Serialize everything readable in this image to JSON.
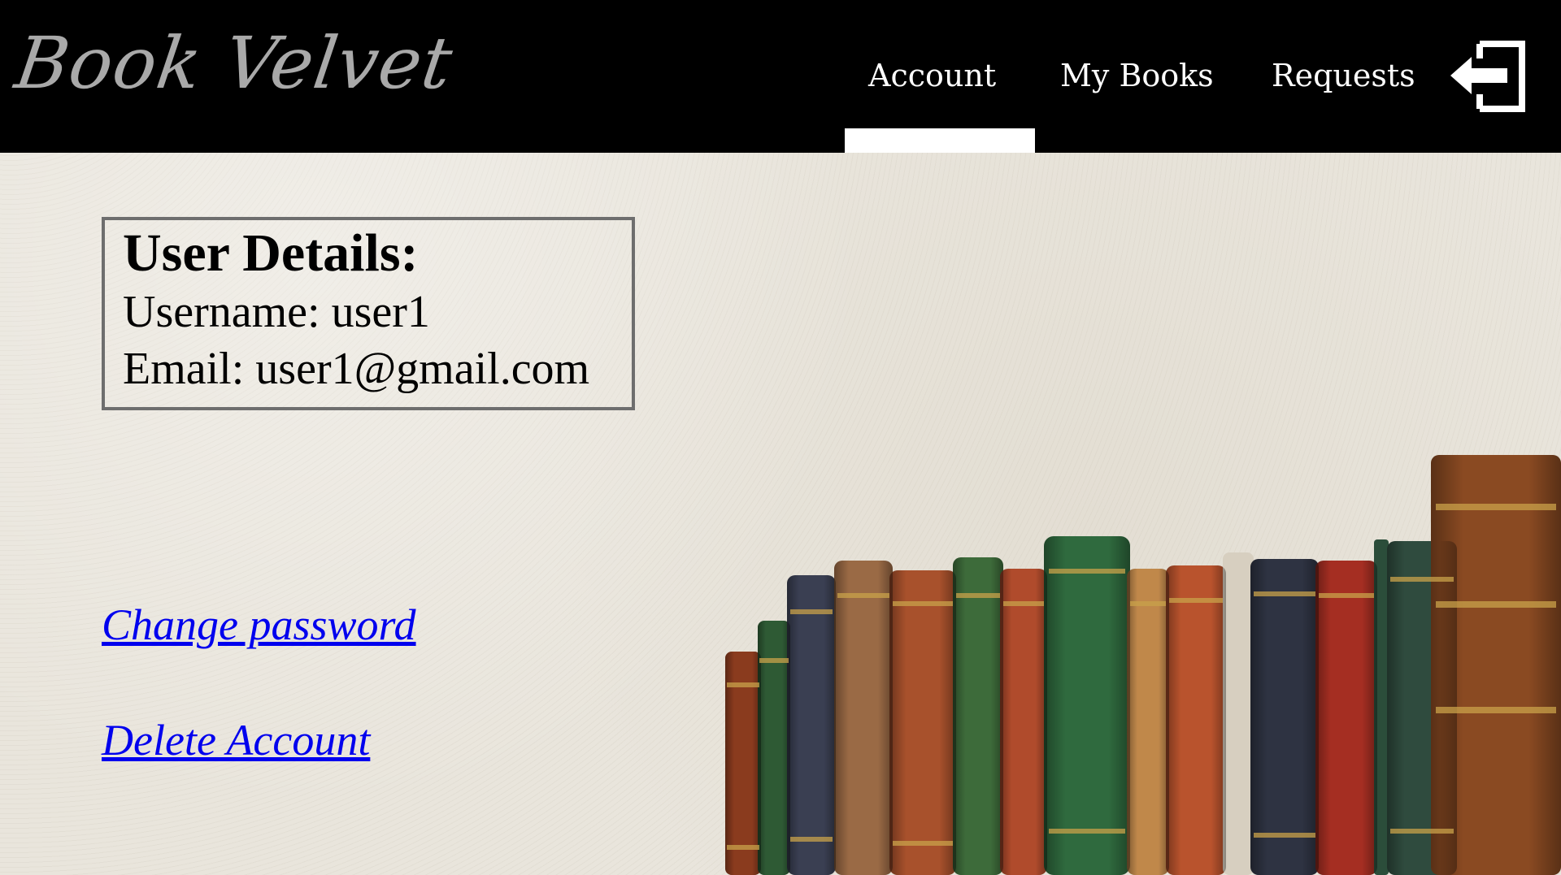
{
  "header": {
    "logo_text": "Book Velvet",
    "nav": {
      "account_label": "Account",
      "my_books_label": "My Books",
      "requests_label": "Requests"
    },
    "active_tab": "Account",
    "logout_icon": "logout-icon"
  },
  "user_details": {
    "title": "User Details:",
    "username_line": "Username: user1",
    "email_line": "Email: user1@gmail.com"
  },
  "links": {
    "change_password": "Change password",
    "delete_account": "Delete Account"
  },
  "illustration": {
    "icon": "bookshelf-illustration"
  },
  "colors": {
    "header_background": "#000000",
    "logo": "#a9a9a9",
    "nav_text": "#ffffff",
    "active_indicator": "#ffffff",
    "page_background": "#e9e5dc",
    "link": "#0000ee",
    "card_border": "#6e6e6e"
  }
}
